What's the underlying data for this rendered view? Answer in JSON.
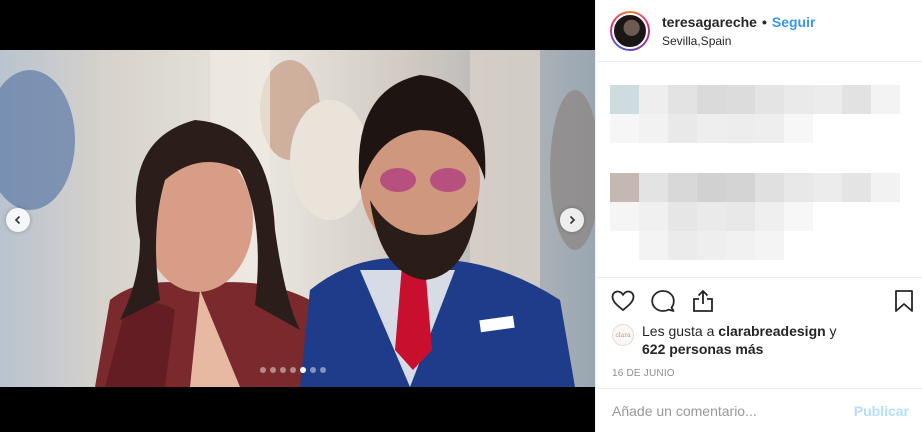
{
  "post": {
    "username": "teresagareche",
    "separator": "•",
    "follow_label": "Seguir",
    "location": "Sevilla,Spain",
    "carousel": {
      "total": 7,
      "active_index": 4
    },
    "likes": {
      "prefix": "Les gusta a ",
      "user": "clarabreadesign",
      "conjunction": " y",
      "others": "622 personas más",
      "avatar_text": "clara"
    },
    "date": "16 DE JUNIO"
  },
  "comment": {
    "placeholder": "Añade un comentario...",
    "publish_label": "Publicar"
  },
  "icons": {
    "like": "heart-icon",
    "comment": "comment-icon",
    "share": "share-icon",
    "save": "bookmark-icon",
    "prev": "chevron-left-icon",
    "next": "chevron-right-icon"
  },
  "colors": {
    "accent": "#3897f0",
    "publish_disabled": "#b2dffc",
    "muted": "#8e8e8e"
  }
}
